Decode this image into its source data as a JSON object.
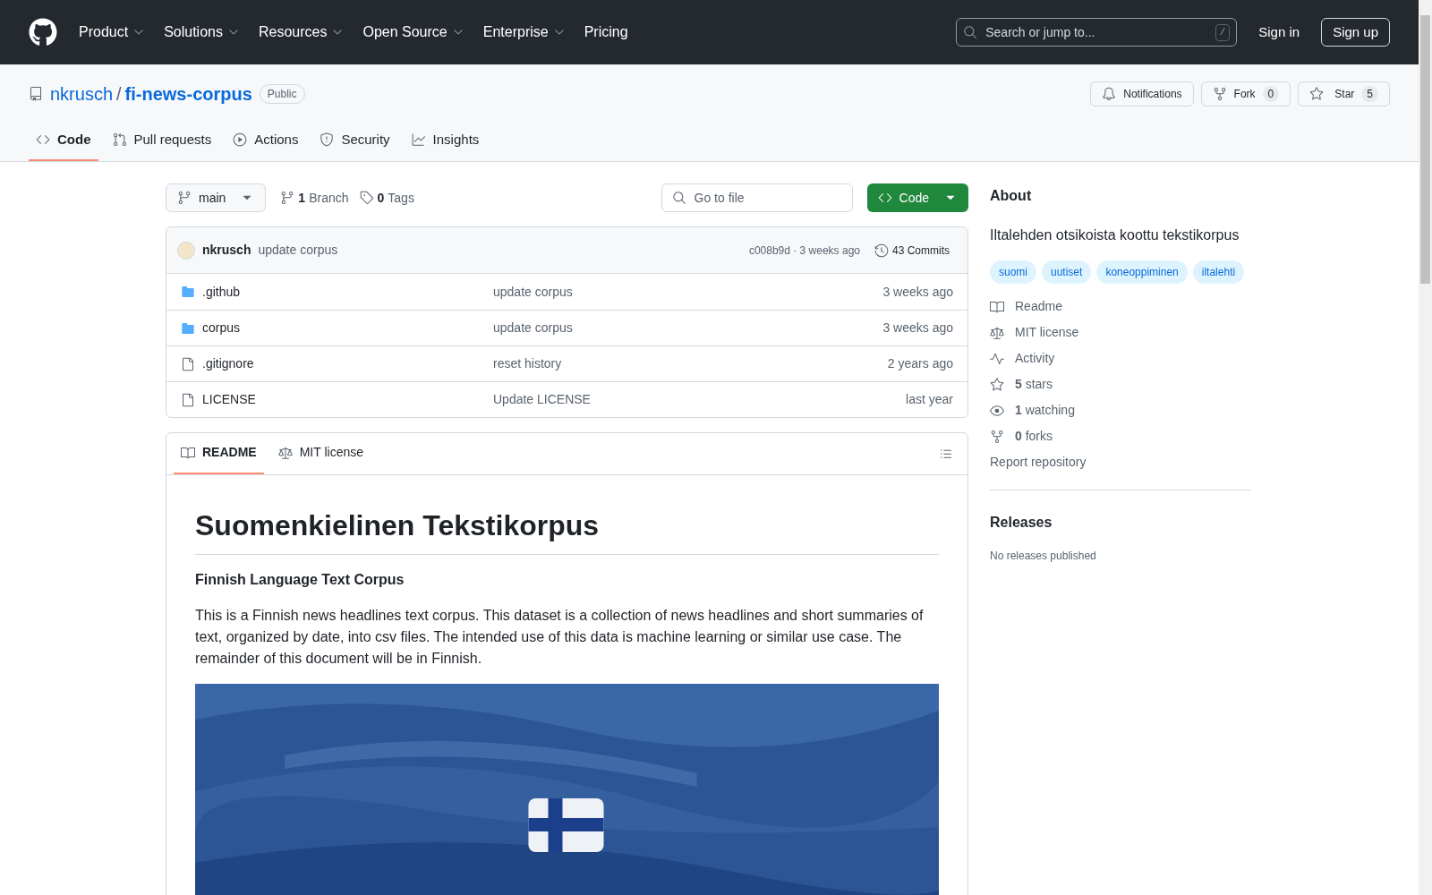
{
  "nav": {
    "items": [
      {
        "label": "Product",
        "dropdown": true
      },
      {
        "label": "Solutions",
        "dropdown": true
      },
      {
        "label": "Resources",
        "dropdown": true
      },
      {
        "label": "Open Source",
        "dropdown": true
      },
      {
        "label": "Enterprise",
        "dropdown": true
      },
      {
        "label": "Pricing",
        "dropdown": false
      }
    ],
    "search": {
      "placeholder": "Search or jump to...",
      "shortcut": "/"
    },
    "sign_in": "Sign in",
    "sign_up": "Sign up"
  },
  "repo": {
    "owner": "nkrusch",
    "separator": "/",
    "name": "fi-news-corpus",
    "visibility": "Public",
    "notifications": "Notifications",
    "fork": {
      "label": "Fork",
      "count": "0"
    },
    "star": {
      "label": "Star",
      "count": "5"
    }
  },
  "tabs": [
    {
      "kind": "code",
      "label": "Code",
      "selected": true
    },
    {
      "kind": "pulls",
      "label": "Pull requests",
      "selected": false
    },
    {
      "kind": "actions",
      "label": "Actions",
      "selected": false
    },
    {
      "kind": "security",
      "label": "Security",
      "selected": false
    },
    {
      "kind": "insights",
      "label": "Insights",
      "selected": false
    }
  ],
  "toolbar": {
    "branch": "main",
    "branch_count": "1",
    "branch_label": "Branch",
    "tag_count": "0",
    "tag_label": "Tags",
    "go_to_file": {
      "placeholder": "Go to file"
    },
    "code_button": "Code"
  },
  "latest_commit": {
    "author": "nkrusch",
    "message": "update corpus",
    "hash_time": "c008b9d · 3 weeks ago",
    "commits": "43 Commits"
  },
  "files": [
    {
      "kind": "folder",
      "name": ".github",
      "message": "update corpus",
      "time": "3 weeks ago"
    },
    {
      "kind": "folder",
      "name": "corpus",
      "message": "update corpus",
      "time": "3 weeks ago"
    },
    {
      "kind": "file",
      "name": ".gitignore",
      "message": "reset history",
      "time": "2 years ago"
    },
    {
      "kind": "file",
      "name": "LICENSE",
      "message": "Update LICENSE",
      "time": "last year"
    }
  ],
  "readme_tabs": [
    {
      "kind": "readme",
      "label": "README",
      "selected": true
    },
    {
      "kind": "license",
      "label": "MIT license",
      "selected": false
    }
  ],
  "readme": {
    "title": "Suomenkielinen Tekstikorpus",
    "subtitle": "Finnish Language Text Corpus",
    "paragraph": "This is a Finnish news headlines text corpus. This dataset is a collection of news headlines and short summaries of text, organized by date, into csv files. The intended use of this data is machine learning or similar use case. The remainder of this document will be in Finnish."
  },
  "about": {
    "title": "About",
    "description": "Iltalehden otsikoista koottu tekstikorpus",
    "topics": [
      "suomi",
      "uutiset",
      "koneoppiminen",
      "iltalehti"
    ],
    "links": [
      {
        "kind": "readme",
        "text": "Readme"
      },
      {
        "kind": "license",
        "text": "MIT license"
      },
      {
        "kind": "activity",
        "text": "Activity"
      },
      {
        "kind": "stars",
        "text": "**5** stars"
      },
      {
        "kind": "watching",
        "text": "**1** watching"
      },
      {
        "kind": "forks",
        "text": "**0** forks"
      }
    ],
    "report": "Report repository"
  },
  "releases": {
    "title": "Releases",
    "empty": "No releases published"
  }
}
